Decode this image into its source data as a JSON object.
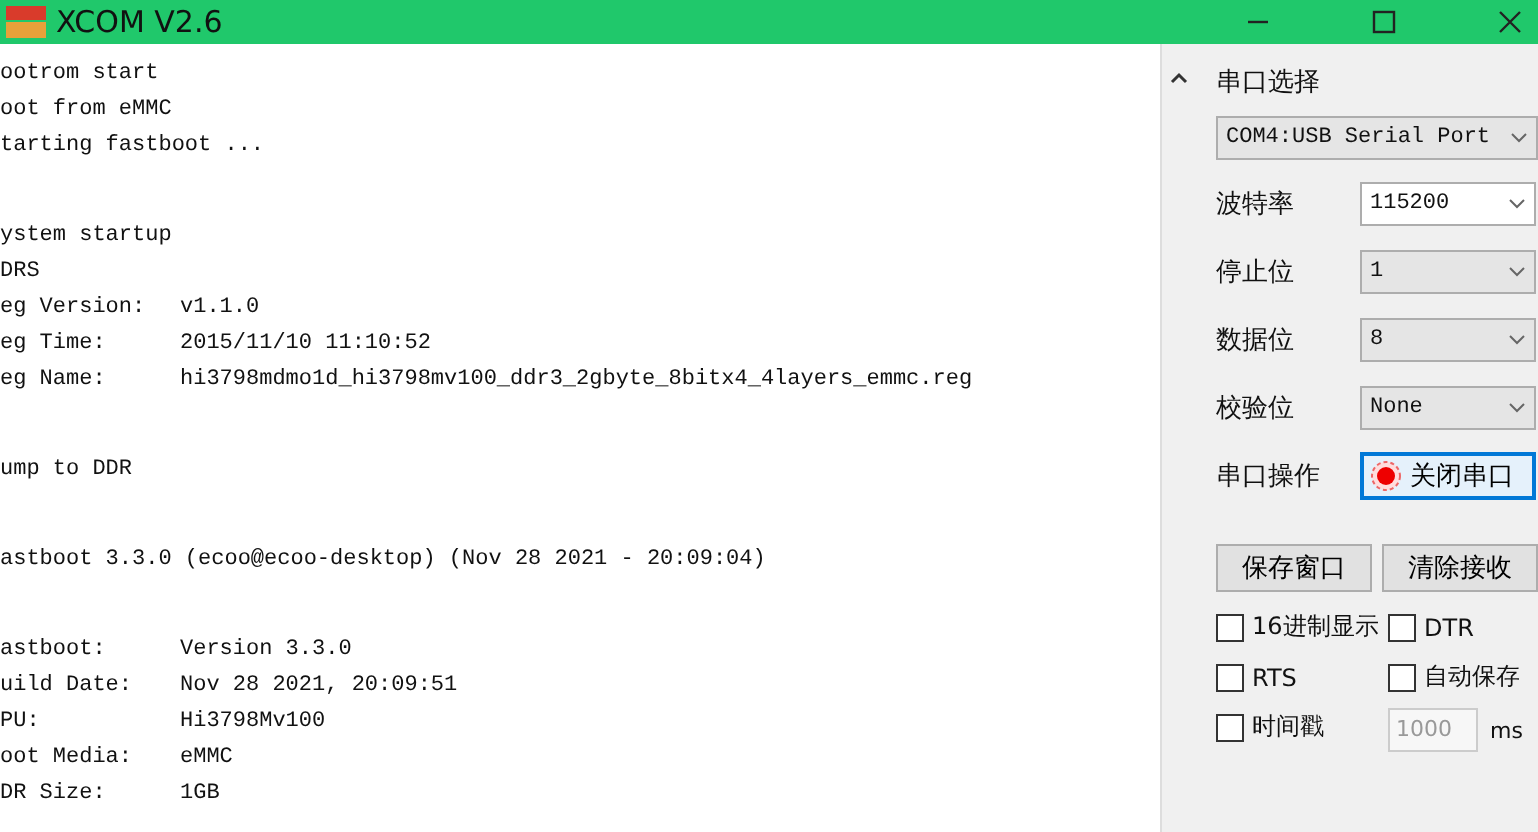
{
  "window": {
    "title": "XCOM V2.6"
  },
  "log": {
    "blocks": [
      [
        {
          "text": "ootrom start"
        },
        {
          "text": "oot from eMMC"
        },
        {
          "text": "tarting fastboot ..."
        }
      ],
      [
        {
          "text": "ystem startup"
        },
        {
          "text": "DRS"
        },
        {
          "label": "eg Version:",
          "value": "v1.1.0"
        },
        {
          "label": "eg Time:",
          "value": "2015/11/10 11:10:52"
        },
        {
          "label": "eg Name:",
          "value": "hi3798mdmo1d_hi3798mv100_ddr3_2gbyte_8bitx4_4layers_emmc.reg"
        }
      ],
      [
        {
          "text": "ump to DDR"
        }
      ],
      [
        {
          "text": "astboot 3.3.0 (ecoo@ecoo-desktop) (Nov 28 2021 - 20:09:04)"
        }
      ],
      [
        {
          "label": "astboot:",
          "value": "Version 3.3.0"
        },
        {
          "label": "uild Date:",
          "value": "Nov 28 2021, 20:09:51"
        },
        {
          "label": "PU:",
          "value": "Hi3798Mv100"
        },
        {
          "label": "oot Media:",
          "value": "eMMC"
        },
        {
          "label": "DR Size:",
          "value": "1GB"
        }
      ]
    ]
  },
  "panel": {
    "port_label": "串口选择",
    "port": "COM4:USB Serial Port",
    "settings": [
      {
        "label": "波特率",
        "value": "115200",
        "editable": true
      },
      {
        "label": "停止位",
        "value": "1",
        "editable": false
      },
      {
        "label": "数据位",
        "value": "8",
        "editable": false
      },
      {
        "label": "校验位",
        "value": "None",
        "editable": false
      }
    ],
    "operation": {
      "label": "串口操作",
      "button": "关闭串口"
    },
    "buttons": [
      "保存窗口",
      "清除接收"
    ],
    "checkboxes": [
      {
        "label": "16进制显示",
        "checked": false
      },
      {
        "label": "DTR",
        "checked": false
      },
      {
        "label": "RTS",
        "checked": false
      },
      {
        "label": "自动保存",
        "checked": false
      },
      {
        "label": "时间戳",
        "checked": false
      }
    ],
    "interval": {
      "value": "1000",
      "disabled": true,
      "unit": "ms"
    }
  }
}
